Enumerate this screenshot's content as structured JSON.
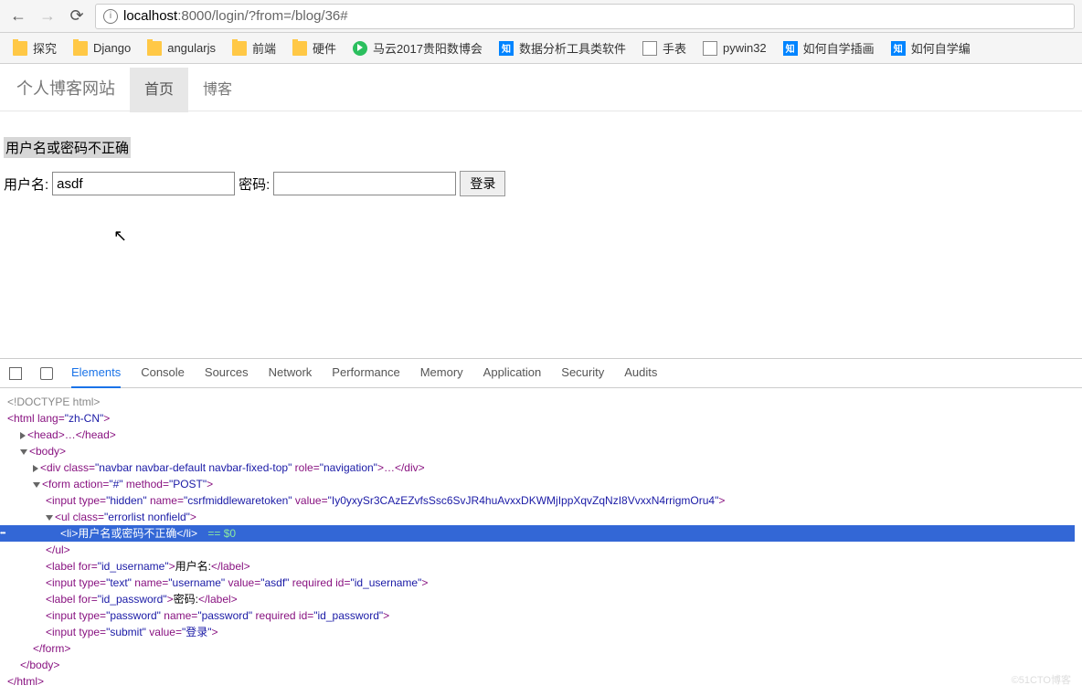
{
  "browser": {
    "url_host": "localhost",
    "url_port": ":8000",
    "url_path": "/login/?from=/blog/36#",
    "info_glyph": "i"
  },
  "bookmarks": [
    {
      "icon": "folder",
      "label": "探究"
    },
    {
      "icon": "folder",
      "label": "Django"
    },
    {
      "icon": "folder",
      "label": "angularjs"
    },
    {
      "icon": "folder",
      "label": "前端"
    },
    {
      "icon": "folder",
      "label": "硬件"
    },
    {
      "icon": "play",
      "label": "马云2017贵阳数博会"
    },
    {
      "icon": "zhihu",
      "label": "数据分析工具类软件"
    },
    {
      "icon": "doc",
      "label": "手表"
    },
    {
      "icon": "doc",
      "label": "pywin32"
    },
    {
      "icon": "zhihu",
      "label": "如何自学插画"
    },
    {
      "icon": "zhihu",
      "label": "如何自学编"
    }
  ],
  "navbar": {
    "brand": "个人博客网站",
    "links": [
      {
        "label": "首页",
        "active": true
      },
      {
        "label": "博客",
        "active": false
      }
    ]
  },
  "form": {
    "error": "用户名或密码不正确",
    "username_label": "用户名:",
    "username_value": "asdf",
    "password_label": "密码:",
    "submit_label": "登录"
  },
  "devtools": {
    "tabs": [
      "Elements",
      "Console",
      "Sources",
      "Network",
      "Performance",
      "Memory",
      "Application",
      "Security",
      "Audits"
    ],
    "active_tab": "Elements",
    "code": {
      "l0": "<!DOCTYPE html>",
      "l1a": "<html lang=",
      "l1b": "\"zh-CN\"",
      "l1c": ">",
      "l2": "<head>…</head>",
      "l3": "<body>",
      "l4a": "<div class=",
      "l4b": "\"navbar navbar-default navbar-fixed-top\"",
      "l4c": " role=",
      "l4d": "\"navigation\"",
      "l4e": ">…</div>",
      "l5a": "<form action=",
      "l5b": "\"#\"",
      "l5c": " method=",
      "l5d": "\"POST\"",
      "l5e": ">",
      "l6a": "<input type=",
      "l6b": "\"hidden\"",
      "l6c": " name=",
      "l6d": "\"csrfmiddlewaretoken\"",
      "l6e": " value=",
      "l6f": "\"Iy0yxySr3CAzEZvfsSsc6SvJR4huAvxxDKWMjIppXqvZqNzI8VvxxN4rrigmOru4\"",
      "l6g": ">",
      "l7a": "<ul class=",
      "l7b": "\"errorlist nonfield\"",
      "l7c": ">",
      "l8a": "<li>",
      "l8b": "用户名或密码不正确",
      "l8c": "</li>",
      "l8d": " == $0",
      "l9": "</ul>",
      "l10a": "<label for=",
      "l10b": "\"id_username\"",
      "l10c": ">",
      "l10d": "用户名:",
      "l10e": "</label>",
      "l11a": "<input type=",
      "l11b": "\"text\"",
      "l11c": " name=",
      "l11d": "\"username\"",
      "l11e": " value=",
      "l11f": "\"asdf\"",
      "l11g": " required id=",
      "l11h": "\"id_username\"",
      "l11i": ">",
      "l12a": "<label for=",
      "l12b": "\"id_password\"",
      "l12c": ">",
      "l12d": "密码:",
      "l12e": "</label>",
      "l13a": "<input type=",
      "l13b": "\"password\"",
      "l13c": " name=",
      "l13d": "\"password\"",
      "l13e": " required id=",
      "l13f": "\"id_password\"",
      "l13g": ">",
      "l14a": "<input type=",
      "l14b": "\"submit\"",
      "l14c": " value=",
      "l14d": "\"登录\"",
      "l14e": ">",
      "l15": "</form>",
      "l16": "</body>",
      "l17": "</html>"
    }
  },
  "watermark": "©51CTO博客"
}
